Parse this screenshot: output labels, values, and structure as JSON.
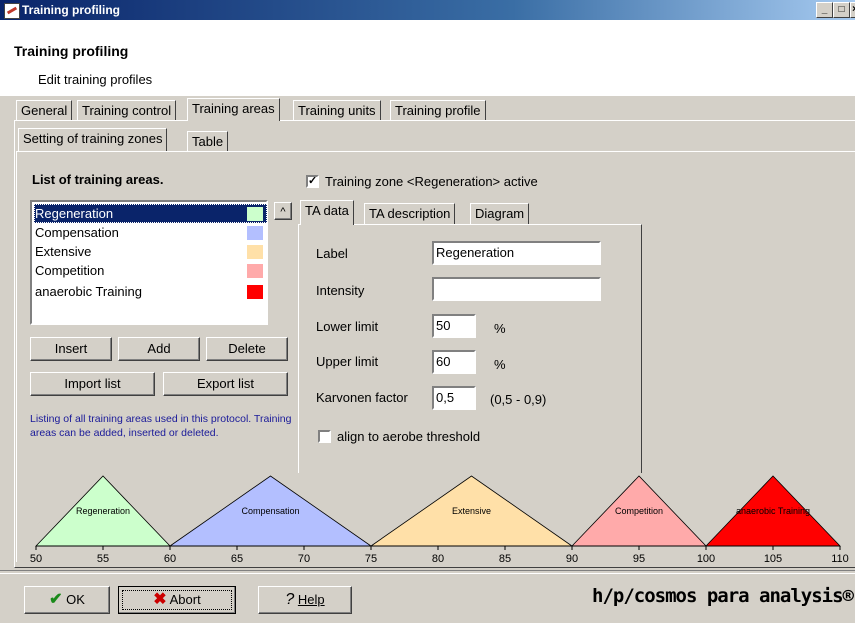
{
  "window": {
    "title": "Training profiling",
    "controls": [
      "_",
      "□",
      "×"
    ]
  },
  "header": {
    "title": "Training profiling",
    "subtitle": "Edit training profiles"
  },
  "main_tabs": [
    {
      "label": "General"
    },
    {
      "label": "Training control"
    },
    {
      "label": "Training areas",
      "active": true
    },
    {
      "label": "Training units"
    },
    {
      "label": "Training profile"
    }
  ],
  "sub_tabs": [
    {
      "label": "Setting of training zones",
      "active": true
    },
    {
      "label": "Table"
    }
  ],
  "list": {
    "heading": "List of training areas.",
    "items": [
      {
        "label": "Regeneration",
        "color": "#ccffcc",
        "selected": true
      },
      {
        "label": "Compensation",
        "color": "#b3bfff"
      },
      {
        "label": "Extensive",
        "color": "#ffe0a8"
      },
      {
        "label": "Competition",
        "color": "#ffaaaa"
      },
      {
        "label": "anaerobic Training",
        "color": "#ff0000"
      }
    ],
    "scroll_up": "^",
    "buttons": {
      "insert": "Insert",
      "add": "Add",
      "delete": "Delete",
      "import": "Import list",
      "export": "Export list"
    },
    "info": "Listing of all training areas used in this protocol. Training areas can be added, inserted or deleted."
  },
  "zone_active": {
    "checked": true,
    "label": "Training zone <Regeneration> active"
  },
  "detail_tabs": [
    {
      "label": "TA data",
      "active": true
    },
    {
      "label": "TA description"
    },
    {
      "label": "Diagram"
    }
  ],
  "form": {
    "label_caption": "Label",
    "label_value": "Regeneration",
    "intensity_caption": "Intensity",
    "intensity_value": "",
    "lower_caption": "Lower limit",
    "lower_value": "50",
    "lower_unit": "%",
    "upper_caption": "Upper limit",
    "upper_value": "60",
    "upper_unit": "%",
    "karvonen_caption": "Karvonen factor",
    "karvonen_value": "0,5",
    "karvonen_range": "(0,5 - 0,9)",
    "align_checked": false,
    "align_label": "align to aerobe threshold"
  },
  "chart_data": {
    "type": "area",
    "x_range": [
      50,
      110
    ],
    "x_ticks": [
      "50",
      "55",
      "60",
      "65",
      "70",
      "75",
      "80",
      "85",
      "90",
      "95",
      "100",
      "105",
      "110"
    ],
    "zones": [
      {
        "name": "Regeneration",
        "from": 50,
        "to": 60,
        "color": "#ccffcc"
      },
      {
        "name": "Compensation",
        "from": 60,
        "to": 75,
        "color": "#b3bfff"
      },
      {
        "name": "Extensive",
        "from": 75,
        "to": 90,
        "color": "#ffe0a8"
      },
      {
        "name": "Competition",
        "from": 90,
        "to": 100,
        "color": "#ffaaaa"
      },
      {
        "name": "anaerobic Training",
        "from": 100,
        "to": 110,
        "color": "#ff0000"
      }
    ]
  },
  "footer": {
    "ok": "OK",
    "abort": "Abort",
    "help": "Help",
    "brand": "h/p/cosmos para analysis®"
  }
}
